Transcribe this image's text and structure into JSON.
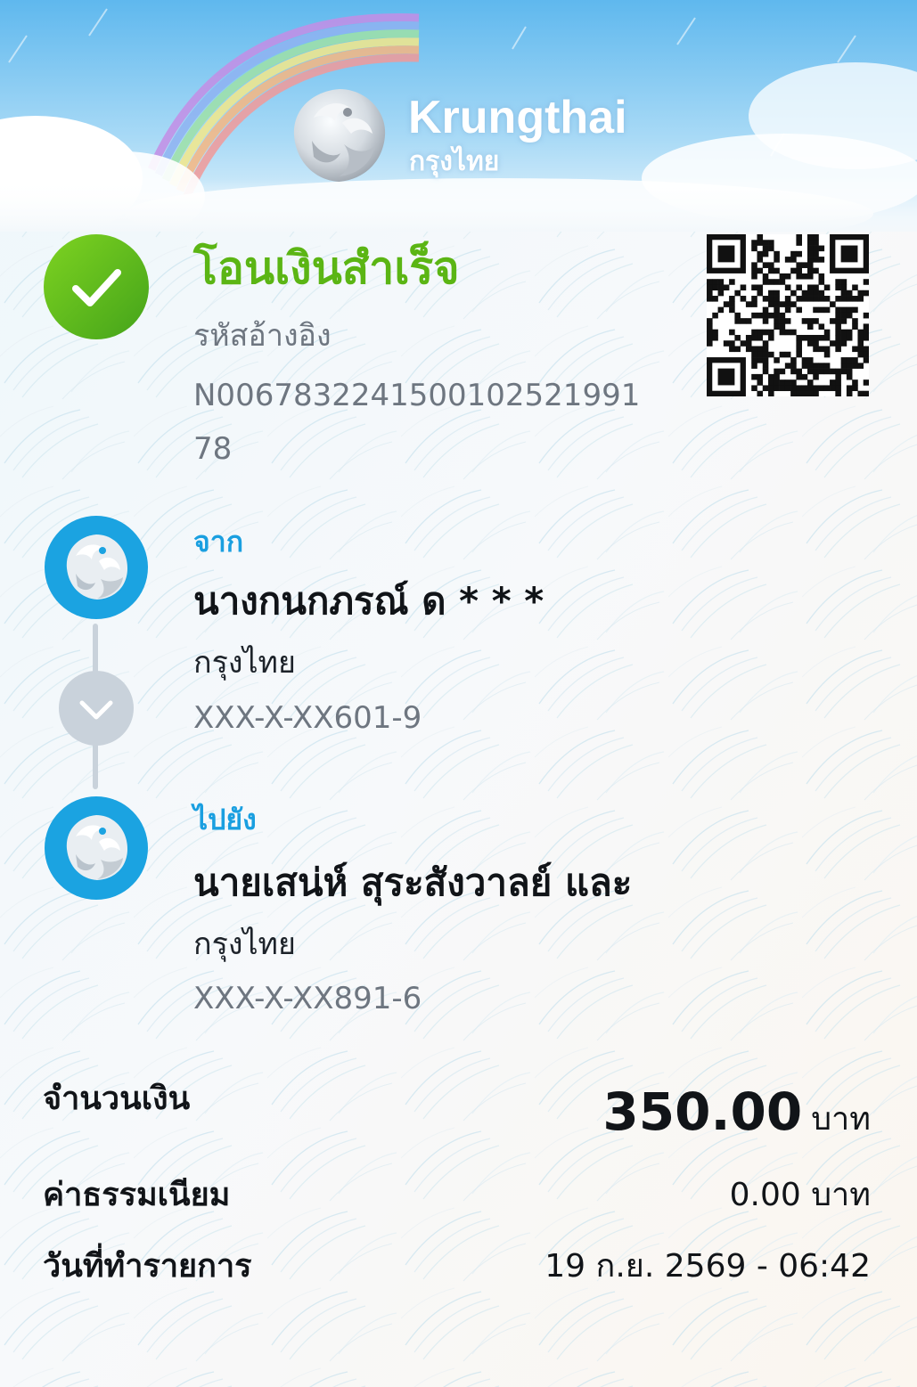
{
  "brand": {
    "name_en": "Krungthai",
    "name_th": "กรุงไทย"
  },
  "colors": {
    "success_green": "#5bb514",
    "label_blue": "#1a9fe0",
    "avatar_blue": "#1ba3e1",
    "text_dark": "#111418",
    "text_gray": "#6e7680"
  },
  "status": {
    "title": "โอนเงินสำเร็จ",
    "icon": "check-circle-icon"
  },
  "reference": {
    "label": "รหัสอ้างอิง",
    "value": "N006783224150010252199178"
  },
  "from": {
    "label": "จาก",
    "name": "นางกนกภรณ์ ด * * *",
    "bank": "กรุงไทย",
    "account": "XXX-X-XX601-9",
    "icon": "krungthai-bank-icon"
  },
  "to": {
    "label": "ไปยัง",
    "name": "นายเสน่ห์ สุระสังวาลย์ และ",
    "bank": "กรุงไทย",
    "account": "XXX-X-XX891-6",
    "icon": "krungthai-bank-icon"
  },
  "summary": {
    "amount_label": "จำนวนเงิน",
    "amount_value": "350.00",
    "amount_unit": "บาท",
    "fee_label": "ค่าธรรมเนียม",
    "fee_value": "0.00 บาท",
    "date_label": "วันที่ทำรายการ",
    "date_value": "19 ก.ย. 2569 - 06:42"
  }
}
